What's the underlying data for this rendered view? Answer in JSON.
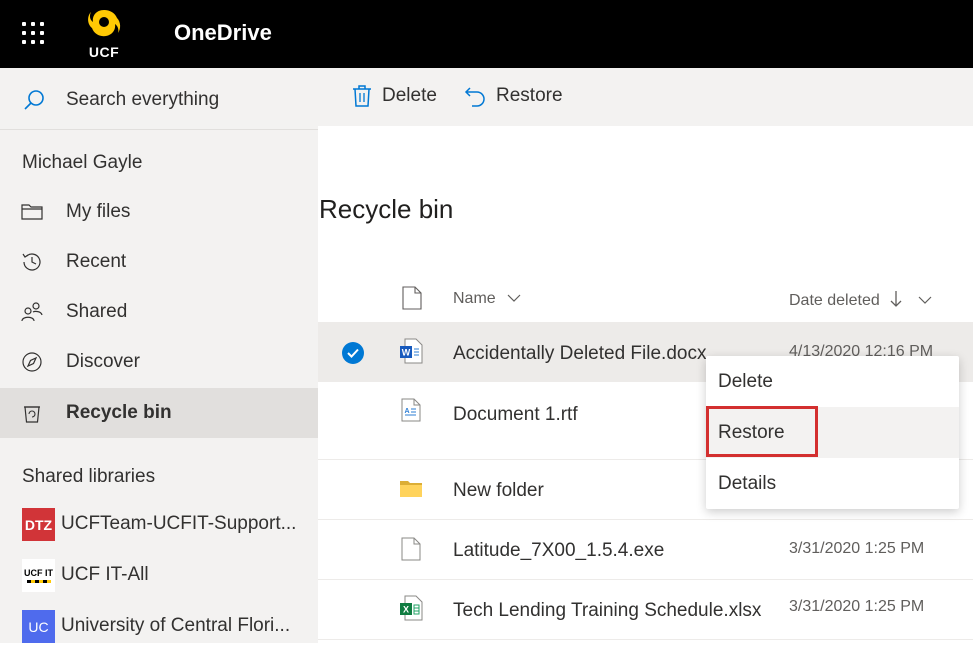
{
  "topbar": {
    "app_title": "OneDrive",
    "logo_text": "UCF"
  },
  "sidebar": {
    "search_label": "Search everything",
    "user_name": "Michael Gayle",
    "nav": [
      {
        "label": "My files",
        "icon": "folder-icon"
      },
      {
        "label": "Recent",
        "icon": "history-icon"
      },
      {
        "label": "Shared",
        "icon": "people-icon"
      },
      {
        "label": "Discover",
        "icon": "compass-icon"
      },
      {
        "label": "Recycle bin",
        "icon": "recycle-bin-icon",
        "active": true
      }
    ],
    "shared_libraries_title": "Shared libraries",
    "libraries": [
      {
        "badge": "DTZ",
        "label": "UCFTeam-UCFIT-Support...",
        "color": "#d13438"
      },
      {
        "badge": "UCF IT",
        "label": "UCF IT-All",
        "color": "#ffffff"
      },
      {
        "badge": "UC",
        "label": "University of Central Flori...",
        "color": "#4f6bed"
      }
    ]
  },
  "commandbar": {
    "delete_label": "Delete",
    "restore_label": "Restore"
  },
  "main": {
    "page_title": "Recycle bin",
    "columns": {
      "name": "Name",
      "date_deleted": "Date deleted"
    },
    "rows": [
      {
        "name": "Accidentally Deleted File.docx",
        "date": "4/13/2020 12:16 PM",
        "type": "word-file-icon",
        "selected": true
      },
      {
        "name": "Document 1.rtf",
        "date": "",
        "type": "text-file-icon"
      },
      {
        "name": "New folder",
        "date": "",
        "type": "folder-icon"
      },
      {
        "name": "Latitude_7X00_1.5.4.exe",
        "date": "3/31/2020 1:25 PM",
        "type": "generic-file-icon"
      },
      {
        "name": "Tech Lending Training Schedule.xlsx",
        "date": "3/31/2020 1:25 PM",
        "type": "excel-file-icon"
      }
    ]
  },
  "context_menu": {
    "items": [
      "Delete",
      "Restore",
      "Details"
    ]
  },
  "colors": {
    "accent": "#0078d4",
    "highlight": "#d32f2f"
  }
}
